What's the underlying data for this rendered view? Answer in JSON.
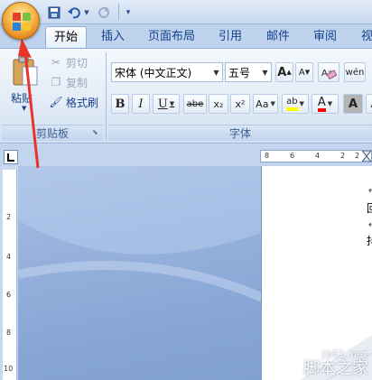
{
  "quick_access": {
    "save_icon": "save-icon",
    "undo_icon": "undo-icon",
    "redo_icon": "redo-icon",
    "customize_icon": "customize-qat-icon"
  },
  "tabs": [
    {
      "label": "开始",
      "active": true
    },
    {
      "label": "插入"
    },
    {
      "label": "页面布局"
    },
    {
      "label": "引用"
    },
    {
      "label": "邮件"
    },
    {
      "label": "审阅"
    },
    {
      "label": "视"
    }
  ],
  "clipboard": {
    "paste_label": "粘贴",
    "cut_label": "剪切",
    "copy_label": "复制",
    "format_painter_label": "格式刷",
    "group_label": "剪贴板"
  },
  "font": {
    "font_name": "宋体 (中文正文)",
    "font_size": "五号",
    "grow_label": "A",
    "shrink_label": "A",
    "bold_label": "B",
    "italic_label": "I",
    "underline_label": "U",
    "strike_label": "abe",
    "subscript_label": "x₂",
    "superscript_label": "x²",
    "change_case_label": "Aa",
    "highlight_label": "ab",
    "font_color_label": "A",
    "shade_label": "A",
    "phonetic_label": "wén",
    "char_border_label": "A",
    "group_label": "字体"
  },
  "ruler": {
    "horizontal": [
      "8",
      "6",
      "4",
      "2",
      "2"
    ],
    "vertical": [
      "2",
      "4",
      "6",
      "8",
      "10"
    ]
  },
  "page_marks": [
    "↵",
    "回",
    "↵",
    "抖"
  ],
  "watermark": {
    "url": "jb51.net",
    "name": "脚本之家"
  },
  "colors": {
    "accent": "#15428b",
    "annotation_arrow": "#e8352b",
    "highlight_yellow": "#ffff00",
    "font_color_red": "#ff0000"
  }
}
